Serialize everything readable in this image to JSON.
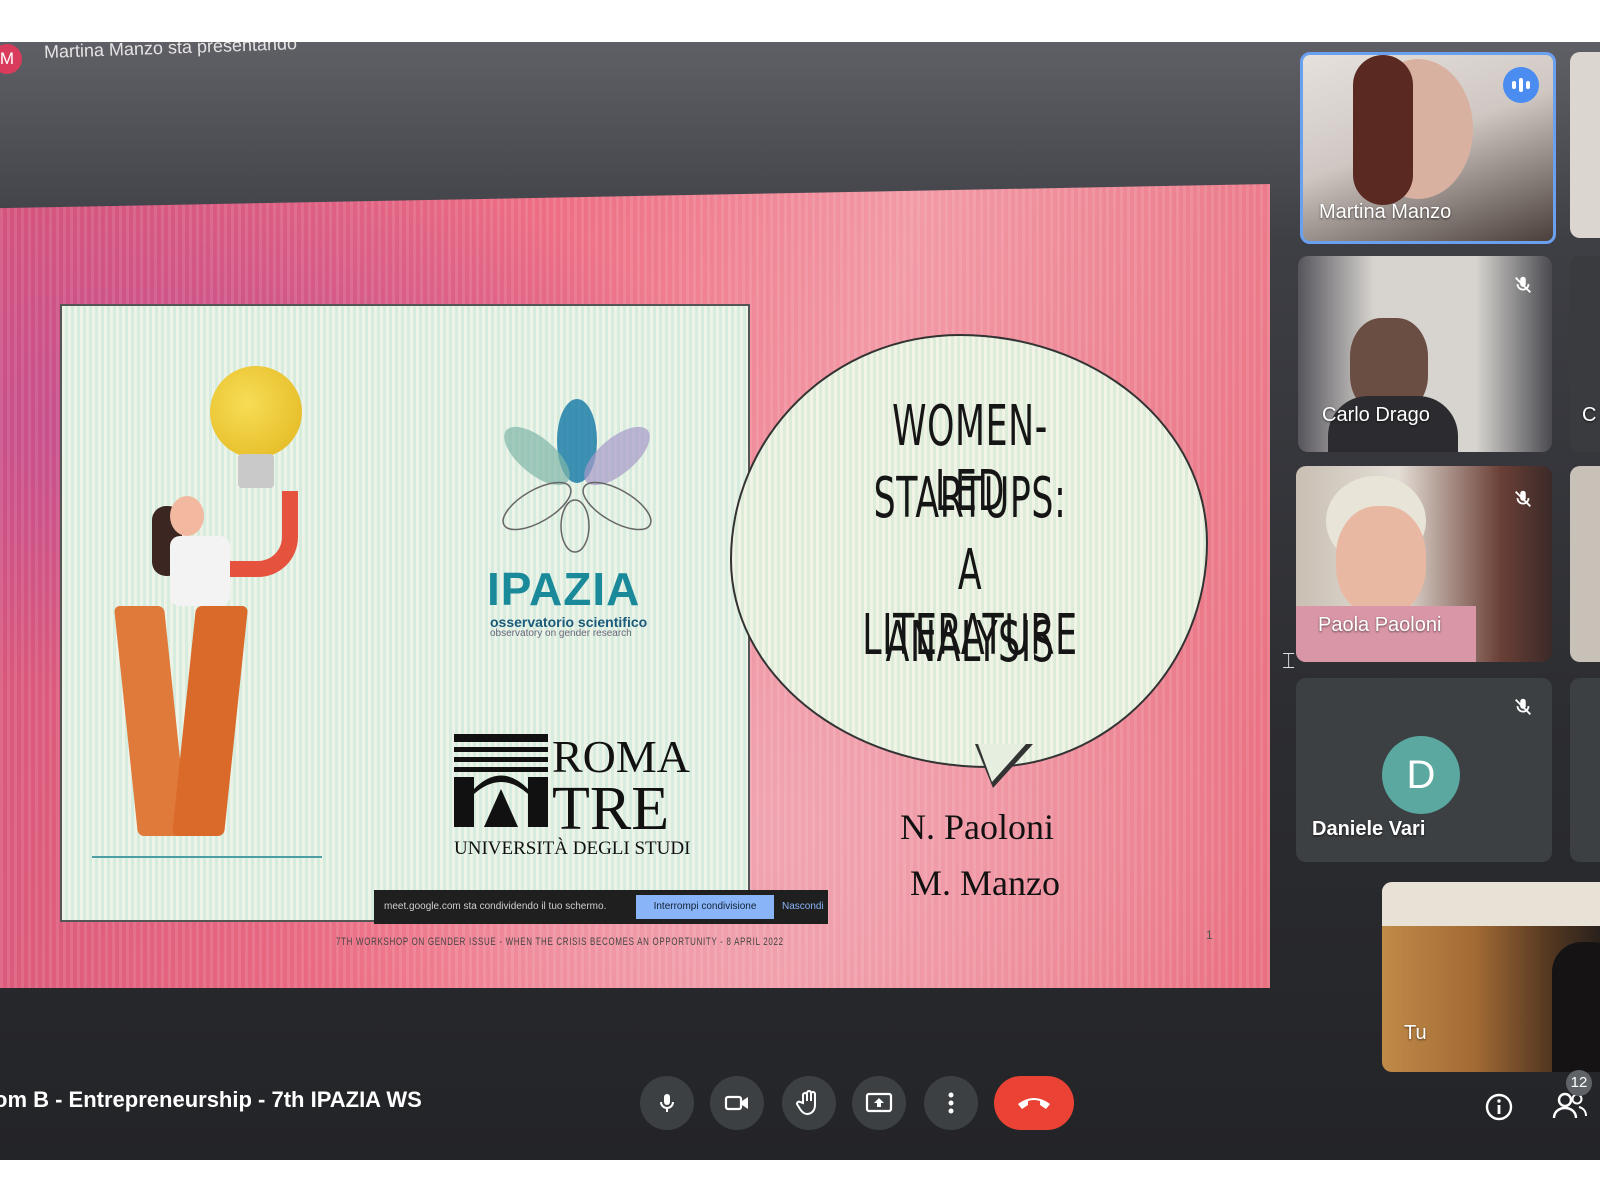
{
  "presenter": {
    "initial": "M",
    "status": "Martina Manzo sta presentando"
  },
  "slide": {
    "logo_name": "IPAZIA",
    "logo_sub": "osservatorio scientifico",
    "logo_sub2": "observatory on gender research",
    "univ_line1": "ROMA",
    "univ_line2": "TRE",
    "univ_line3": "UNIVERSITÀ DEGLI STUDI",
    "title_lines": [
      "WOMEN-LED",
      "STARTUPS:",
      "A LITERATURE",
      "ANALYSIS"
    ],
    "authors": [
      "N. Paoloni",
      "M. Manzo"
    ],
    "footer": "7TH WORKSHOP ON GENDER ISSUE - WHEN THE CRISIS BECOMES AN OPPORTUNITY - 8 APRIL 2022",
    "page_number": "1"
  },
  "share_banner": {
    "text": "meet.google.com sta condividendo il tuo schermo.",
    "stop_label": "Interrompi condivisione",
    "hide_label": "Nascondi"
  },
  "participants": [
    {
      "name": "Martina Manzo",
      "speaking": true
    },
    {
      "name": "Carlo Drago",
      "muted": true
    },
    {
      "name": "Paola Paoloni",
      "muted": true
    },
    {
      "name": "Daniele Vari",
      "muted": true,
      "initial": "D"
    },
    {
      "name": "Tu"
    }
  ],
  "meeting": {
    "name": "om B - Entrepreneurship - 7th IPAZIA WS"
  },
  "controls": {
    "mic_icon": "microphone-icon",
    "camera_icon": "camera-icon",
    "hand_icon": "raise-hand-icon",
    "present_icon": "present-screen-icon",
    "more_icon": "more-vert-icon",
    "hangup_icon": "hangup-icon",
    "info_icon": "info-icon",
    "people_icon": "people-icon",
    "people_count": "12"
  },
  "colors": {
    "hangup": "#ea4335",
    "speaking": "#4a8cf0",
    "avatar_d": "#5aa8a0"
  }
}
